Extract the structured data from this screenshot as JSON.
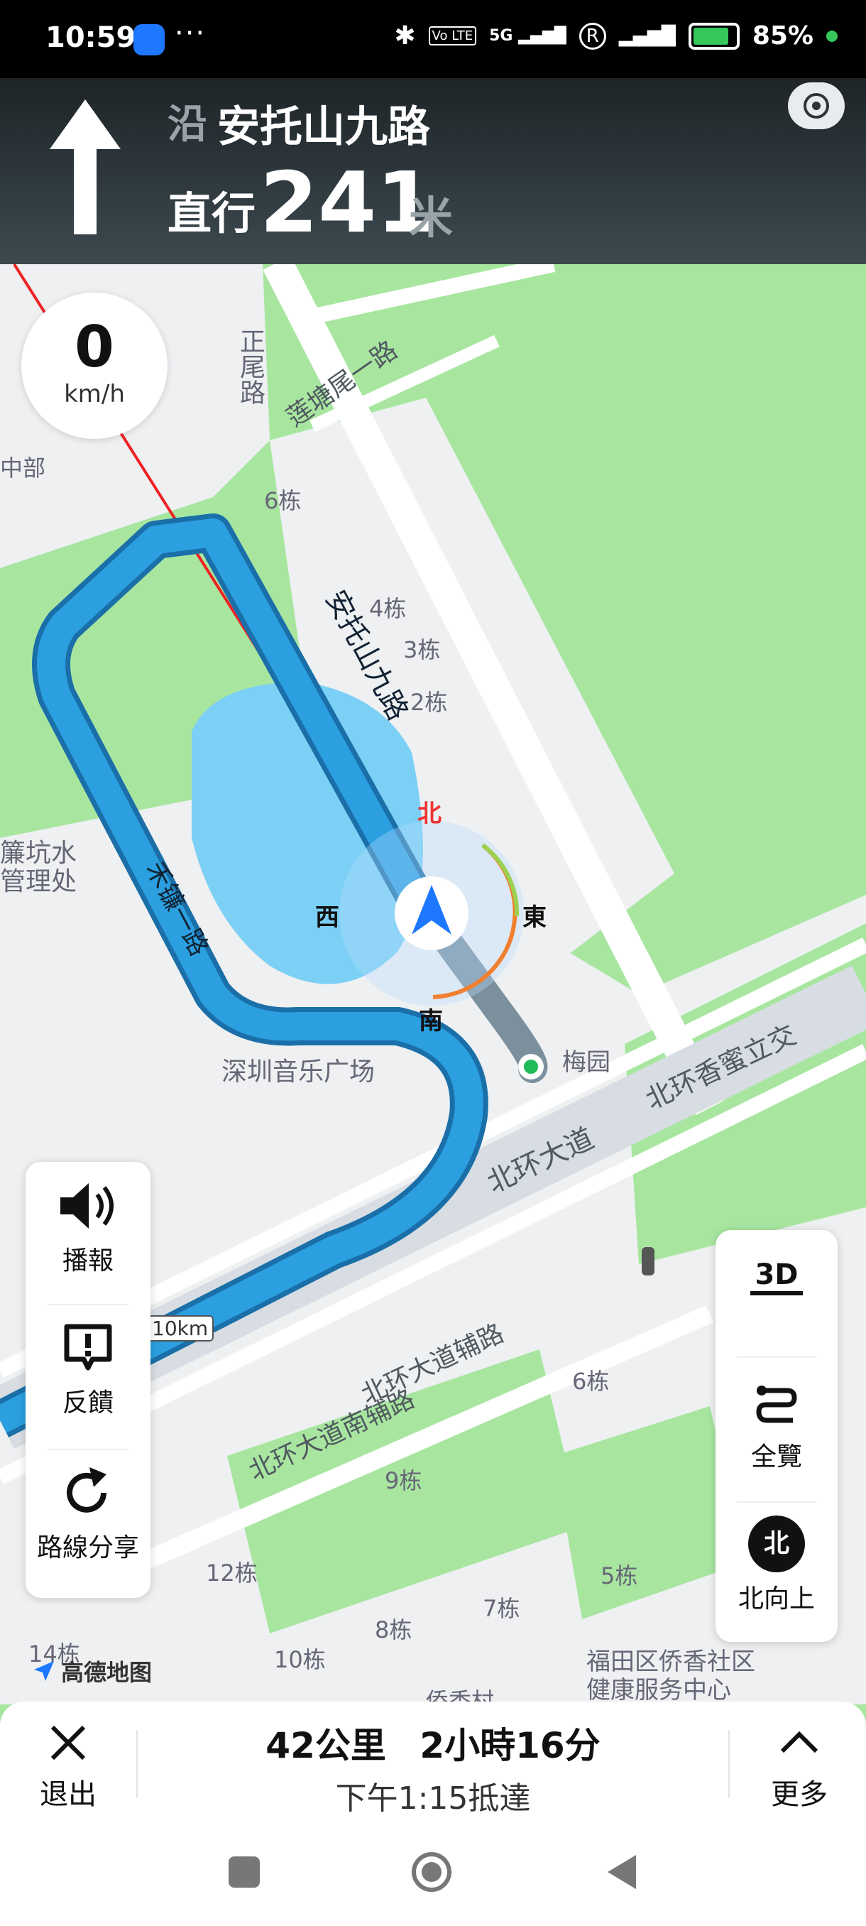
{
  "status_bar": {
    "time": "10:59",
    "more": "···",
    "network": "5G",
    "volte": "Vo LTE",
    "roaming": "R",
    "battery_percent": "85%",
    "battery_level": 0.85
  },
  "nav_header": {
    "along_prefix": "沿",
    "road_name": "安托山九路",
    "action": "直行",
    "distance": "241",
    "distance_unit": "米"
  },
  "speed": {
    "value": "0",
    "unit": "km/h"
  },
  "compass": {
    "north": "北",
    "east": "東",
    "south": "南",
    "west": "西"
  },
  "map_labels": {
    "road_zhengwei": "正尾路",
    "road_liantang": "莲塘尾一路",
    "road_antuoshan9": "安托山九路",
    "road_hezhen": "禾镰一路",
    "road_beihuan": "北环大道",
    "road_beihuan_fulu": "北环大道辅路",
    "road_beihuan_nanfulu": "北环大道南辅路",
    "interchange": "北环香蜜立交",
    "music_square": "深圳音乐广场",
    "meiyuan": "梅园",
    "water_office_line1": "簾坑水",
    "water_office_line2": "管理处",
    "zhongbu": "中部",
    "health_center_line1": "福田区侨香社区",
    "health_center_line2": "健康服务中心",
    "qiaoxiang_village": "侨香村",
    "b6_north": "6栋",
    "b4": "4栋",
    "b3": "3栋",
    "b2": "2栋",
    "b6_south": "6栋",
    "b9": "9栋",
    "b12": "12栋",
    "b5": "5栋",
    "b7": "7栋",
    "b8": "8栋",
    "b10": "10栋",
    "b14": "14栋",
    "scale": "10km",
    "logo": "高德地图"
  },
  "left_panel": {
    "broadcast": "播報",
    "feedback": "反饋",
    "share_route": "路線分享"
  },
  "right_panel": {
    "mode_3d": "3D",
    "overview": "全覽",
    "north_up_icon_text": "北",
    "north_up": "北向上"
  },
  "bottom_bar": {
    "exit": "退出",
    "distance": "42公里",
    "duration": "2小時16分",
    "eta": "下午1:15抵達",
    "more": "更多"
  },
  "colors": {
    "route_blue": "#2b9fe0",
    "map_green": "#a8e6a0",
    "water_blue": "#7ccff5",
    "header_dark": "#2a3236"
  }
}
